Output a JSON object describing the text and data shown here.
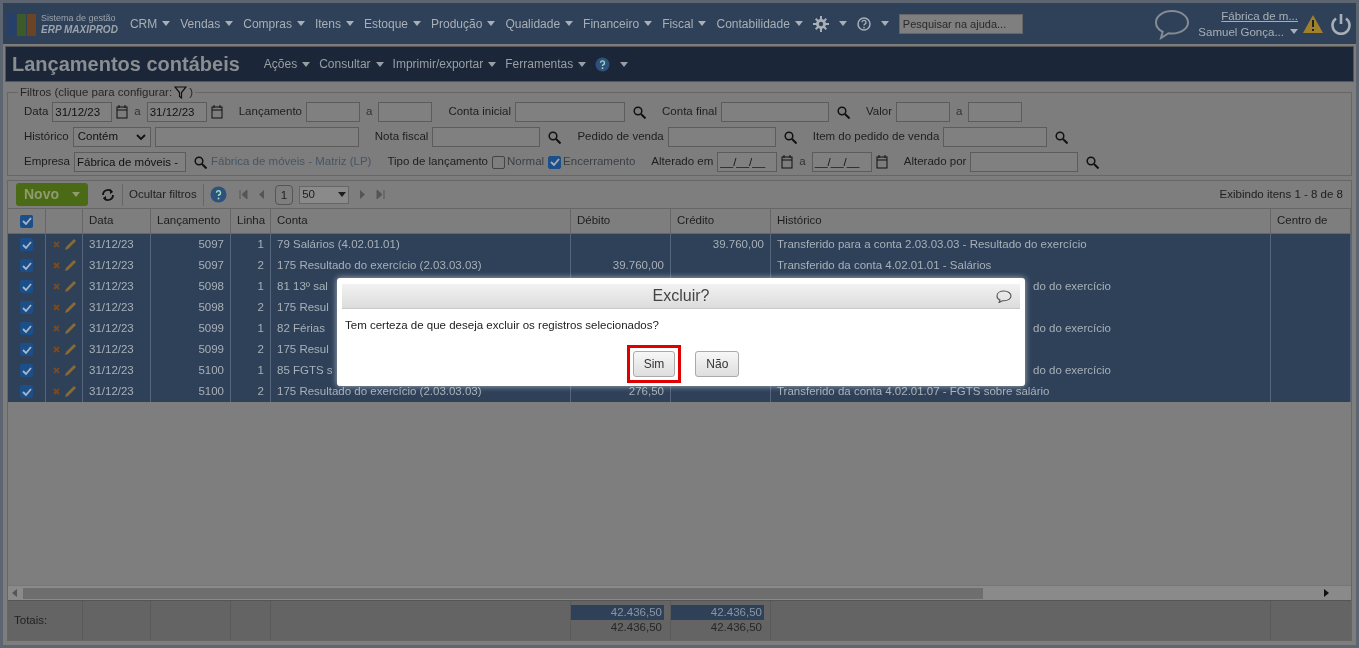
{
  "nav": {
    "logo_top": "Sistema de gestão",
    "logo_bottom": "ERP MAXIPROD",
    "menus": [
      "CRM",
      "Vendas",
      "Compras",
      "Itens",
      "Estoque",
      "Produção",
      "Qualidade",
      "Financeiro",
      "Fiscal",
      "Contabilidade"
    ],
    "search": {
      "placeholder": "Pesquisar na ajuda..."
    },
    "company": "Fábrica de m...",
    "user": "Samuel Gonça..."
  },
  "page": {
    "title": "Lançamentos contábeis",
    "menus": [
      "Ações",
      "Consultar",
      "Imprimir/exportar",
      "Ferramentas"
    ]
  },
  "filters": {
    "legend": "Filtros (clique para configurar:",
    "closing": ")",
    "rows": [
      {
        "items": [
          {
            "kind": "label",
            "text": "Data"
          },
          {
            "kind": "input",
            "value": "31/12/23"
          },
          {
            "kind": "calendar"
          },
          {
            "kind": "joiner",
            "text": "a"
          },
          {
            "kind": "input",
            "value": "31/12/23"
          },
          {
            "kind": "calendar"
          },
          {
            "kind": "label",
            "text": "Lançamento"
          },
          {
            "kind": "input"
          },
          {
            "kind": "joiner",
            "text": "a"
          },
          {
            "kind": "input"
          },
          {
            "kind": "label",
            "text": "Conta inicial"
          },
          {
            "kind": "input"
          },
          {
            "kind": "lookup"
          },
          {
            "kind": "label",
            "text": "Conta final"
          },
          {
            "kind": "input"
          },
          {
            "kind": "lookup"
          },
          {
            "kind": "label",
            "text": "Valor"
          },
          {
            "kind": "input"
          },
          {
            "kind": "joiner",
            "text": "a"
          },
          {
            "kind": "input"
          }
        ]
      },
      {
        "items": [
          {
            "kind": "label",
            "text": "Histórico"
          },
          {
            "kind": "select",
            "value": "Contém"
          },
          {
            "kind": "input"
          },
          {
            "kind": "label",
            "text": "Nota fiscal"
          },
          {
            "kind": "input"
          },
          {
            "kind": "lookup"
          },
          {
            "kind": "label",
            "text": "Pedido de venda"
          },
          {
            "kind": "input"
          },
          {
            "kind": "lookup"
          },
          {
            "kind": "label",
            "text": "Item do pedido de venda"
          },
          {
            "kind": "input"
          },
          {
            "kind": "lookup"
          }
        ]
      },
      {
        "items": [
          {
            "kind": "label",
            "text": "Empresa"
          },
          {
            "kind": "input",
            "value": "Fábrica de móveis -"
          },
          {
            "kind": "lookup"
          },
          {
            "kind": "note",
            "text": "Fábrica de móveis - Matriz (LP)"
          },
          {
            "kind": "label",
            "text": "Tipo de lançamento"
          },
          {
            "kind": "checkbox",
            "text": "Normal",
            "checked": false
          },
          {
            "kind": "checkbox",
            "text": "Encerramento",
            "checked": true
          },
          {
            "kind": "label",
            "text": "Alterado em"
          },
          {
            "kind": "input",
            "value": "__/__/__"
          },
          {
            "kind": "calendar"
          },
          {
            "kind": "joiner",
            "text": "a"
          },
          {
            "kind": "input",
            "value": "__/__/__"
          },
          {
            "kind": "calendar"
          },
          {
            "kind": "label",
            "text": "Alterado por"
          },
          {
            "kind": "input"
          },
          {
            "kind": "lookup"
          }
        ]
      }
    ]
  },
  "toolbar": {
    "new_button": "Novo",
    "hide_filters": "Ocultar filtros",
    "page": "1",
    "page_size": "50",
    "summary": "Exibindo itens 1 - 8 de 8"
  },
  "table": {
    "all_selected": true,
    "columns": [
      "Data",
      "Lançamento",
      "Linha",
      "Conta",
      "Débito",
      "Crédito",
      "Histórico",
      "Centro de"
    ],
    "rows": [
      {
        "selected": true,
        "data": "31/12/23",
        "lancamento": "5097",
        "linha": "1",
        "conta": "79 Salários (4.02.01.01)",
        "credito": "39.760,00",
        "historico": "Transferido para a conta 2.03.03.03 - Resultado do exercício"
      },
      {
        "selected": true,
        "data": "31/12/23",
        "lancamento": "5097",
        "linha": "2",
        "conta": "175 Resultado do exercício (2.03.03.03)",
        "debito": "39.760,00",
        "historico": "Transferido da conta 4.02.01.01 - Salários"
      },
      {
        "selected": true,
        "data": "31/12/23",
        "lancamento": "5098",
        "linha": "1",
        "conta": "81 13º sal",
        "historico": "do do exercício",
        "covered": true
      },
      {
        "selected": true,
        "data": "31/12/23",
        "lancamento": "5098",
        "linha": "2",
        "conta": "175 Resul"
      },
      {
        "selected": true,
        "data": "31/12/23",
        "lancamento": "5099",
        "linha": "1",
        "conta": "82 Férias",
        "historico": "do do exercício",
        "covered": true
      },
      {
        "selected": true,
        "data": "31/12/23",
        "lancamento": "5099",
        "linha": "2",
        "conta": "175 Resul"
      },
      {
        "selected": true,
        "data": "31/12/23",
        "lancamento": "5100",
        "linha": "1",
        "conta": "85 FGTS s",
        "historico": "do do exercício",
        "covered": true
      },
      {
        "selected": true,
        "data": "31/12/23",
        "lancamento": "5100",
        "linha": "2",
        "conta": "175 Resultado do exercício (2.03.03.03)",
        "debito": "276,50",
        "historico": "Transferido da conta 4.02.01.07 - FGTS sobre salário"
      }
    ],
    "totals": {
      "label": "Totais:",
      "debito": [
        "42.436,50",
        "42.436,50"
      ],
      "credito": [
        "42.436,50",
        "42.436,50"
      ]
    }
  },
  "dialog": {
    "title": "Excluir?",
    "message": "Tem certeza de que deseja excluir os registros selecionados?",
    "buttons": [
      {
        "label": "Sim",
        "focused": true
      },
      {
        "label": "Não",
        "focused": false
      }
    ]
  }
}
